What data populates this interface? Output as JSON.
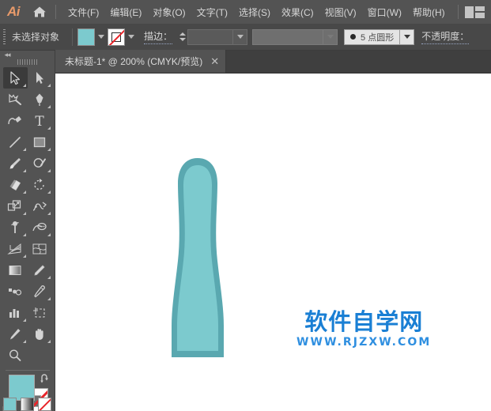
{
  "app": {
    "logo": "Ai",
    "home_icon": "home-icon",
    "workspace_icon": "workspace-switcher-icon"
  },
  "menubar": {
    "items": [
      {
        "label": "文件(F)",
        "name": "menu-file"
      },
      {
        "label": "编辑(E)",
        "name": "menu-edit"
      },
      {
        "label": "对象(O)",
        "name": "menu-object"
      },
      {
        "label": "文字(T)",
        "name": "menu-type"
      },
      {
        "label": "选择(S)",
        "name": "menu-select"
      },
      {
        "label": "效果(C)",
        "name": "menu-effect"
      },
      {
        "label": "视图(V)",
        "name": "menu-view"
      },
      {
        "label": "窗口(W)",
        "name": "menu-window"
      },
      {
        "label": "帮助(H)",
        "name": "menu-help"
      }
    ]
  },
  "controlbar": {
    "selection_status": "未选择对象",
    "fill_color": "#7ccace",
    "stroke_color": "none",
    "stroke_label": "描边：",
    "stroke_weight_value": "",
    "stroke_weight_placeholder": "",
    "variable_width_profile": "",
    "brush_definition": "5 点圆形",
    "brush_number": "5",
    "opacity_label": "不透明度："
  },
  "tabbar": {
    "document_title": "未标题-1* @ 200% (CMYK/预览)",
    "close_label": "✕"
  },
  "toolpanel": {
    "collapse_label": "◂◂",
    "tools": [
      {
        "name": "selection-tool",
        "label": "选择工具",
        "icon": "arrow-solid-outline-icon",
        "active": true,
        "corner": true
      },
      {
        "name": "direct-selection-tool",
        "label": "直接选择工具",
        "icon": "arrow-filled-icon",
        "active": false,
        "corner": true
      },
      {
        "name": "magic-wand-tool",
        "label": "魔棒工具",
        "icon": "magic-wand-icon",
        "active": false,
        "corner": false
      },
      {
        "name": "pen-tool",
        "label": "钢笔工具",
        "icon": "pen-icon",
        "active": false,
        "corner": true
      },
      {
        "name": "curvature-tool",
        "label": "曲率工具",
        "icon": "curvature-icon",
        "active": false,
        "corner": false
      },
      {
        "name": "type-tool",
        "label": "文字工具",
        "icon": "type-T-icon",
        "active": false,
        "corner": true
      },
      {
        "name": "line-segment-tool",
        "label": "直线段工具",
        "icon": "line-icon",
        "active": false,
        "corner": true
      },
      {
        "name": "rectangle-tool",
        "label": "矩形工具",
        "icon": "rectangle-icon",
        "active": false,
        "corner": true
      },
      {
        "name": "paintbrush-tool",
        "label": "画笔工具",
        "icon": "paintbrush-icon",
        "active": false,
        "corner": true
      },
      {
        "name": "shaper-tool",
        "label": "Shaper 工具",
        "icon": "shaper-icon",
        "active": false,
        "corner": true
      },
      {
        "name": "eraser-tool",
        "label": "橡皮擦工具",
        "icon": "eraser-icon",
        "active": false,
        "corner": true
      },
      {
        "name": "rotate-tool",
        "label": "旋转工具",
        "icon": "rotate-icon",
        "active": false,
        "corner": true
      },
      {
        "name": "scale-tool",
        "label": "比例缩放工具",
        "icon": "scale-icon",
        "active": false,
        "corner": true
      },
      {
        "name": "width-tool",
        "label": "宽度工具",
        "icon": "width-warp-icon",
        "active": false,
        "corner": true
      },
      {
        "name": "free-transform-tool",
        "label": "自由变换工具",
        "icon": "free-transform-pin-icon",
        "active": false,
        "corner": true
      },
      {
        "name": "shape-builder-tool",
        "label": "形状生成器工具",
        "icon": "shape-builder-icon",
        "active": false,
        "corner": true
      },
      {
        "name": "perspective-grid-tool",
        "label": "透视网格工具",
        "icon": "perspective-grid-icon",
        "active": false,
        "corner": true
      },
      {
        "name": "mesh-tool",
        "label": "网格工具",
        "icon": "mesh-icon",
        "active": false,
        "corner": false
      },
      {
        "name": "gradient-tool",
        "label": "渐变工具",
        "icon": "gradient-icon",
        "active": false,
        "corner": false
      },
      {
        "name": "eyedropper-tool",
        "label": "吸管工具",
        "icon": "ruler-measure-icon",
        "active": false,
        "corner": true
      },
      {
        "name": "blend-tool",
        "label": "混合工具",
        "icon": "blend-icon",
        "active": false,
        "corner": false
      },
      {
        "name": "eyedropper-pick-tool",
        "label": "吸管工具",
        "icon": "eyedropper-icon",
        "active": false,
        "corner": true
      },
      {
        "name": "column-graph-tool",
        "label": "柱形图工具",
        "icon": "bar-chart-icon",
        "active": false,
        "corner": true
      },
      {
        "name": "artboard-tool",
        "label": "画板工具",
        "icon": "artboard-icon",
        "active": false,
        "corner": false
      },
      {
        "name": "slice-tool",
        "label": "切片工具",
        "icon": "slice-knife-icon",
        "active": false,
        "corner": true
      },
      {
        "name": "hand-tool",
        "label": "抓手工具",
        "icon": "hand-icon",
        "active": false,
        "corner": true
      },
      {
        "name": "zoom-tool",
        "label": "缩放工具",
        "icon": "magnifier-icon",
        "active": false,
        "corner": false
      }
    ],
    "color_control": {
      "fill": "#7ccace",
      "stroke": "none",
      "swap_icon": "swap-arrows-icon",
      "default_icon": "default-colors-icon"
    },
    "modes": [
      {
        "name": "fill-color-mode",
        "icon": "solid-color-icon",
        "active": true
      },
      {
        "name": "gradient-mode",
        "icon": "gradient-swatch-icon",
        "active": false
      },
      {
        "name": "none-mode",
        "icon": "none-swatch-icon",
        "active": false
      }
    ]
  },
  "canvas": {
    "artwork": {
      "name": "toothbrush-handle-shape",
      "outer_color": "#5aa8b0",
      "inner_color": "#7ccace"
    },
    "watermark": {
      "main": "软件自学网",
      "sub": "WWW.RJZXW.COM",
      "color": "#1a7fd4"
    }
  }
}
